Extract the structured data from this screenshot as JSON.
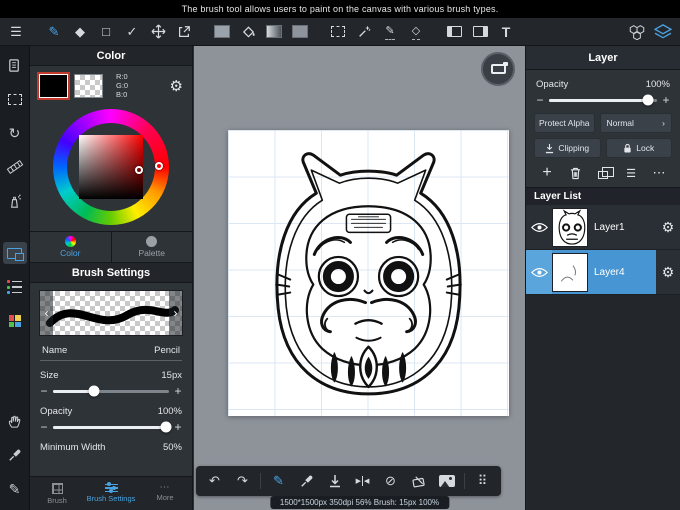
{
  "notification_bar": {
    "text": "The brush tool allows users to paint on the canvas with various brush types."
  },
  "icons": {
    "menu": "☰",
    "brush": "✎",
    "eraser_tool": "◆",
    "shape_tool": "□",
    "pen_check": "✓",
    "select_pen": "✎",
    "select_eraser": "◇",
    "text_tool": "T",
    "undo": "↶",
    "redo": "↷",
    "rotate": "↻",
    "pencil": "✎",
    "gear": "⚙",
    "plus": "+",
    "minus": "−",
    "more": "⋯",
    "list": "☰",
    "chevron_left": "‹",
    "chevron_right": "›",
    "blend_chevron": "›",
    "no_draw": "⊘",
    "flip_a": "▶",
    "flip_b": "◀",
    "drag_handle": "⠿"
  },
  "color_panel": {
    "title": "Color",
    "rgb_r": "R:0",
    "rgb_g": "G:0",
    "rgb_b": "B:0",
    "tab_color": "Color",
    "tab_palette": "Palette"
  },
  "brush_panel": {
    "title": "Brush Settings",
    "name_label": "Name",
    "name_value": "Pencil",
    "size_label": "Size",
    "size_value": "15px",
    "opacity_label": "Opacity",
    "opacity_value": "100%",
    "min_width_label": "Minimum Width",
    "min_width_value": "50%",
    "tab_brush": "Brush",
    "tab_settings": "Brush Settings",
    "tab_more": "More"
  },
  "layer_panel": {
    "title": "Layer",
    "opacity_label": "Opacity",
    "opacity_value": "100%",
    "protect_alpha": "Protect Alpha",
    "blend_mode": "Normal",
    "clipping": "Clipping",
    "lock": "Lock",
    "list_title": "Layer List",
    "layers": [
      {
        "name": "Layer1"
      },
      {
        "name": "Layer4"
      }
    ]
  },
  "canvas": {
    "status": "1500*1500px 350dpi 56% Brush: 15px 100%"
  },
  "colors": {
    "accent": "#4aa3e0",
    "selected_layer": "#4795d2",
    "panel_bg": "#2e3338",
    "toolbar_bg": "#23272c",
    "canvas_surround": "#8e939a"
  }
}
